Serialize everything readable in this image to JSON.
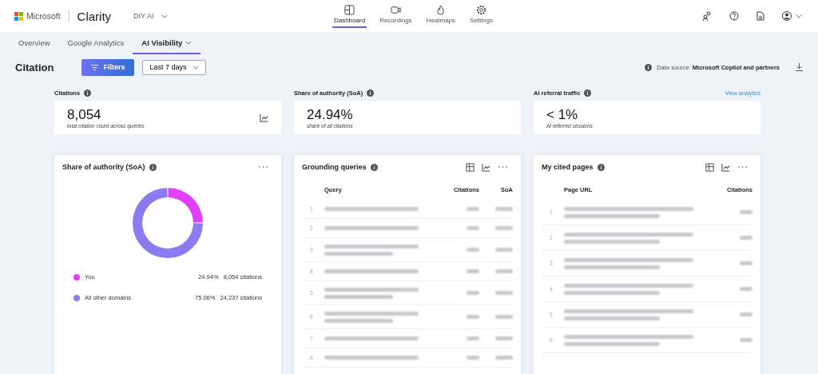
{
  "header": {
    "brand": "Microsoft",
    "product": "Clarity",
    "project": "DIY AI",
    "nav": [
      {
        "label": "Dashboard",
        "selected": true
      },
      {
        "label": "Recordings",
        "selected": false
      },
      {
        "label": "Heatmaps",
        "selected": false
      },
      {
        "label": "Settings",
        "selected": false
      }
    ]
  },
  "tabs": [
    {
      "label": "Overview",
      "selected": false,
      "dropdown": false
    },
    {
      "label": "Google Analytics",
      "selected": false,
      "dropdown": false
    },
    {
      "label": "AI Visibility",
      "selected": true,
      "dropdown": true
    }
  ],
  "toolbar": {
    "title": "Citation",
    "filters": "Filters",
    "range": "Last 7 days",
    "source_label": "Data source:",
    "source": "Microsoft Copilot and partners"
  },
  "kpis": [
    {
      "label": "Citations",
      "value": "8,054",
      "caption": "total citation count across queries",
      "trend_icon": true
    },
    {
      "label": "Share of authority (SoA)",
      "value": "24.94%",
      "caption": "share of all citations",
      "trend_icon": false
    },
    {
      "label": "AI referral traffic",
      "value": "< 1%",
      "caption": "AI referred sessions",
      "trend_icon": false,
      "link": "View analytics"
    }
  ],
  "soa_card": {
    "title": "Share of authority (SoA)",
    "chart_data": {
      "type": "donut",
      "categories": [
        "You",
        "All other domains"
      ],
      "values": [
        24.94,
        75.06
      ]
    },
    "legend": [
      {
        "percent": "24.94%",
        "count": "8,054 citations",
        "color": "#e040fb"
      },
      {
        "percent": "75.06%",
        "count": "24,237 citations",
        "color": "#8a7cf0"
      }
    ]
  },
  "queries_card": {
    "title": "Grounding queries",
    "columns": [
      "Query",
      "Citations",
      "SoA"
    ],
    "rows": [
      {
        "rank": "1",
        "wrapped": false
      },
      {
        "rank": "2",
        "wrapped": false
      },
      {
        "rank": "3",
        "wrapped": true
      },
      {
        "rank": "4",
        "wrapped": false
      },
      {
        "rank": "5",
        "wrapped": true
      },
      {
        "rank": "6",
        "wrapped": true
      },
      {
        "rank": "7",
        "wrapped": false
      },
      {
        "rank": "8",
        "wrapped": false
      }
    ]
  },
  "pages_card": {
    "title": "My cited pages",
    "columns": [
      "Page URL",
      "Citations"
    ],
    "rows": [
      {
        "rank": "1",
        "wrapped": true
      },
      {
        "rank": "2",
        "wrapped": true
      },
      {
        "rank": "3",
        "wrapped": true
      },
      {
        "rank": "4",
        "wrapped": true
      },
      {
        "rank": "5",
        "wrapped": true
      },
      {
        "rank": "6",
        "wrapped": true
      }
    ]
  }
}
